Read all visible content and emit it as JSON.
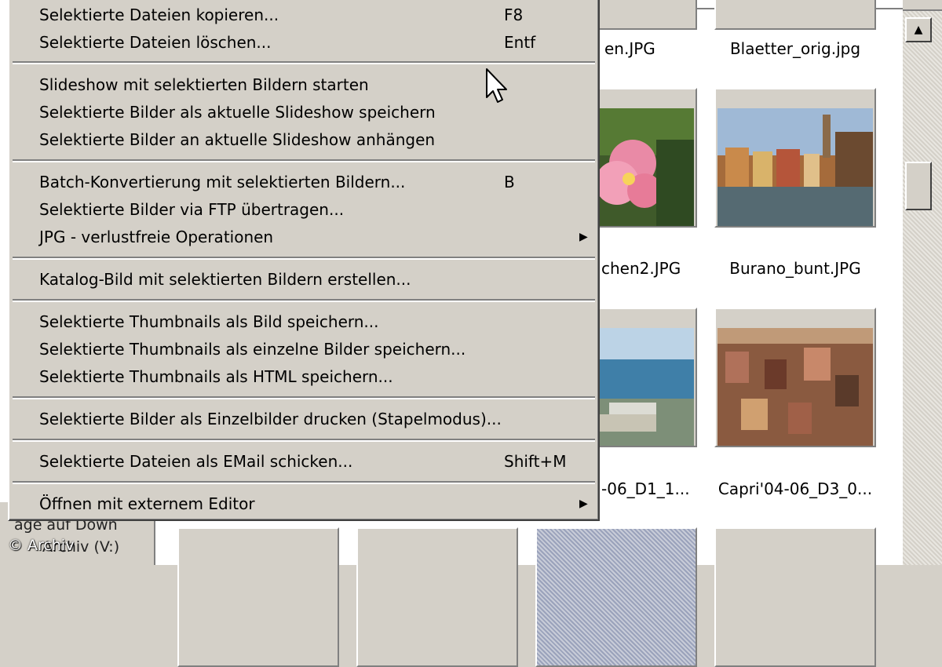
{
  "menu": {
    "items": [
      {
        "label": "Selektierte Dateien kopieren...",
        "shortcut": "F8"
      },
      {
        "label": "Selektierte Dateien löschen...",
        "shortcut": "Entf"
      },
      {
        "label": "Slideshow mit selektierten Bildern starten",
        "shortcut": ""
      },
      {
        "label": "Selektierte Bilder als aktuelle Slideshow speichern",
        "shortcut": ""
      },
      {
        "label": "Selektierte Bilder an aktuelle Slideshow anhängen",
        "shortcut": ""
      },
      {
        "label": "Batch-Konvertierung mit selektierten Bildern...",
        "shortcut": "B"
      },
      {
        "label": "Selektierte Bilder via FTP übertragen...",
        "shortcut": ""
      },
      {
        "label": "JPG - verlustfreie Operationen",
        "shortcut": "",
        "submenu": true
      },
      {
        "label": "Katalog-Bild mit selektierten Bildern erstellen...",
        "shortcut": ""
      },
      {
        "label": "Selektierte Thumbnails als Bild speichern...",
        "shortcut": ""
      },
      {
        "label": "Selektierte Thumbnails als einzelne Bilder speichern...",
        "shortcut": ""
      },
      {
        "label": "Selektierte Thumbnails als HTML speichern...",
        "shortcut": ""
      },
      {
        "label": "Selektierte Bilder als Einzelbilder drucken (Stapelmodus)...",
        "shortcut": ""
      },
      {
        "label": "Selektierte Dateien als EMail schicken...",
        "shortcut": "Shift+M"
      },
      {
        "label": "Öffnen mit externem Editor",
        "shortcut": "",
        "submenu": true
      }
    ],
    "submenu_arrow": "▶"
  },
  "thumbnails": {
    "captions": [
      "en.JPG",
      "Blaetter_orig.jpg",
      "chen2.JPG",
      "Burano_bunt.JPG",
      "-06_D1_1...",
      "Capri'04-06_D3_0..."
    ]
  },
  "left_pane": {
    "line1": "age auf   Down",
    "line2": "Archiv (V:)"
  },
  "copyright": "© Archiv",
  "scrollbar": {
    "up_arrow": "▲"
  },
  "colors": {
    "face": "#d4d0c8",
    "shadow": "#808080",
    "highlight": "#ffffff"
  }
}
